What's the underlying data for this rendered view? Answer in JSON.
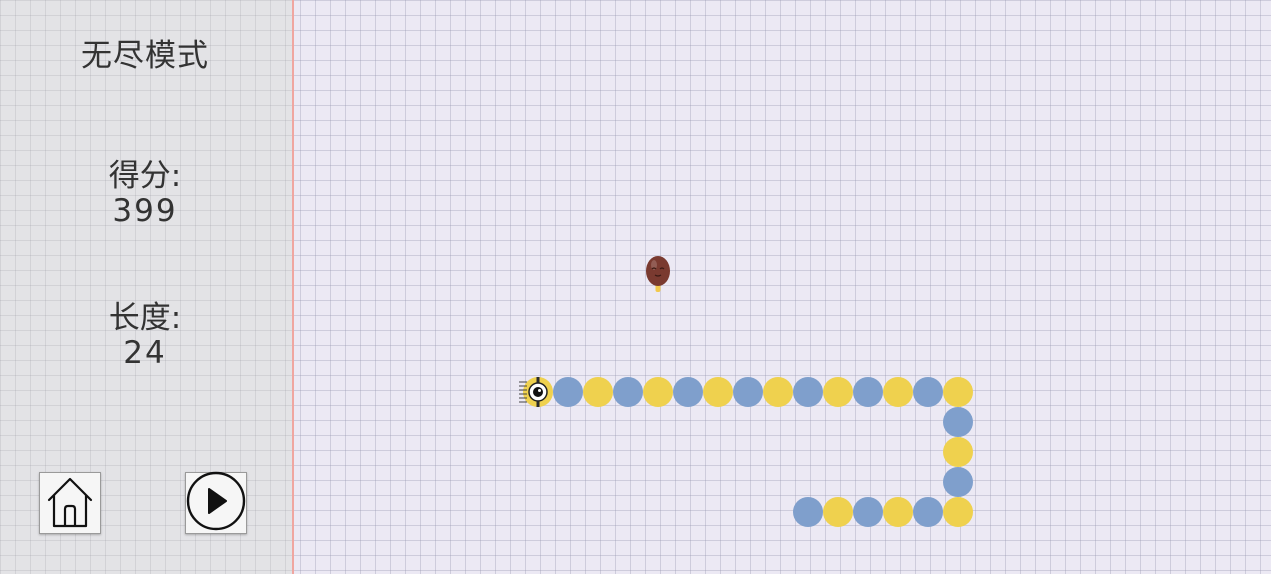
{
  "sidebar": {
    "mode_title": "无尽模式",
    "score_label": "得分:",
    "score_value": "399",
    "length_label": "长度:",
    "length_value": "24",
    "home_icon": "home-icon",
    "play_icon": "play-icon"
  },
  "game": {
    "colors": {
      "segment_blue": "#7f9fcc",
      "segment_yellow": "#efd14e",
      "food_body": "#7a3a30",
      "food_stick": "#f2c94c"
    },
    "food": {
      "col": 12,
      "row": 9
    },
    "snake_head_direction": "left",
    "snake_cells": [
      [
        8,
        13
      ],
      [
        9,
        13
      ],
      [
        10,
        13
      ],
      [
        11,
        13
      ],
      [
        12,
        13
      ],
      [
        13,
        13
      ],
      [
        14,
        13
      ],
      [
        15,
        13
      ],
      [
        16,
        13
      ],
      [
        17,
        13
      ],
      [
        18,
        13
      ],
      [
        19,
        13
      ],
      [
        20,
        13
      ],
      [
        21,
        13
      ],
      [
        22,
        13
      ],
      [
        22,
        14
      ],
      [
        22,
        15
      ],
      [
        22,
        16
      ],
      [
        22,
        17
      ],
      [
        21,
        17
      ],
      [
        20,
        17
      ],
      [
        19,
        17
      ],
      [
        18,
        17
      ],
      [
        17,
        17
      ]
    ]
  }
}
